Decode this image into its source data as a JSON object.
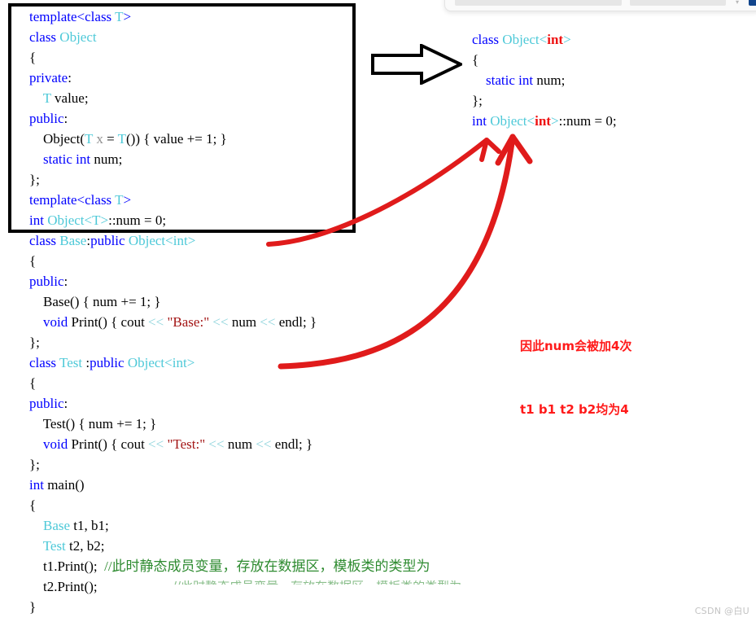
{
  "toolbar_fragment": {
    "input_primary_placeholder": "",
    "input_secondary_placeholder": "",
    "caret_glyph": "▾",
    "button_label": "",
    "accent_color": "#11458c"
  },
  "template_box": {
    "border_color": "#000000",
    "lines": [
      {
        "id": "l1",
        "indent": 0,
        "tokens": [
          {
            "t": "template",
            "c": "kw"
          },
          {
            "t": "<",
            "c": "kw"
          },
          {
            "t": "class",
            "c": "kw"
          },
          {
            "t": " ",
            "c": "plain"
          },
          {
            "t": "T",
            "c": "typ"
          },
          {
            "t": ">",
            "c": "kw"
          }
        ]
      },
      {
        "id": "l2",
        "indent": 0,
        "tokens": [
          {
            "t": "class",
            "c": "kw"
          },
          {
            "t": " ",
            "c": "plain"
          },
          {
            "t": "Object",
            "c": "typ"
          }
        ]
      },
      {
        "id": "l3",
        "indent": 0,
        "tokens": [
          {
            "t": "{",
            "c": "plain"
          }
        ]
      },
      {
        "id": "l4",
        "indent": 0,
        "tokens": [
          {
            "t": "private",
            "c": "kw"
          },
          {
            "t": ":",
            "c": "plain"
          }
        ]
      },
      {
        "id": "l5",
        "indent": 1,
        "tokens": [
          {
            "t": "T",
            "c": "typ"
          },
          {
            "t": " value;",
            "c": "plain"
          }
        ]
      },
      {
        "id": "l6",
        "indent": 0,
        "tokens": [
          {
            "t": "public",
            "c": "kw"
          },
          {
            "t": ":",
            "c": "plain"
          }
        ]
      },
      {
        "id": "l7",
        "indent": 1,
        "tokens": [
          {
            "t": "Object",
            "c": "plain"
          },
          {
            "t": "(",
            "c": "plain"
          },
          {
            "t": "T",
            "c": "typ"
          },
          {
            "t": " ",
            "c": "plain"
          },
          {
            "t": "x",
            "c": "param"
          },
          {
            "t": " = ",
            "c": "plain"
          },
          {
            "t": "T",
            "c": "typ"
          },
          {
            "t": "()) { value += 1; }",
            "c": "plain"
          }
        ]
      },
      {
        "id": "l8",
        "indent": 1,
        "tokens": [
          {
            "t": "static",
            "c": "kw"
          },
          {
            "t": " ",
            "c": "plain"
          },
          {
            "t": "int",
            "c": "kw"
          },
          {
            "t": " num;",
            "c": "plain"
          }
        ]
      },
      {
        "id": "l9",
        "indent": 0,
        "tokens": [
          {
            "t": "};",
            "c": "plain"
          }
        ]
      },
      {
        "id": "l10",
        "indent": 0,
        "tokens": [
          {
            "t": "template",
            "c": "kw"
          },
          {
            "t": "<",
            "c": "kw"
          },
          {
            "t": "class",
            "c": "kw"
          },
          {
            "t": " ",
            "c": "plain"
          },
          {
            "t": "T",
            "c": "typ"
          },
          {
            "t": ">",
            "c": "kw"
          }
        ]
      },
      {
        "id": "l11",
        "indent": 0,
        "tokens": [
          {
            "t": "int",
            "c": "kw"
          },
          {
            "t": " ",
            "c": "plain"
          },
          {
            "t": "Object",
            "c": "typ"
          },
          {
            "t": "<",
            "c": "typ"
          },
          {
            "t": "T",
            "c": "typ"
          },
          {
            "t": ">",
            "c": "typ"
          },
          {
            "t": "::num = 0;",
            "c": "plain"
          }
        ]
      }
    ]
  },
  "left_code_rest": {
    "lines": [
      {
        "id": "r1",
        "indent": 0,
        "tokens": [
          {
            "t": "class",
            "c": "kw"
          },
          {
            "t": " ",
            "c": "plain"
          },
          {
            "t": "Base",
            "c": "typ"
          },
          {
            "t": ":",
            "c": "plain"
          },
          {
            "t": "public",
            "c": "kw"
          },
          {
            "t": " ",
            "c": "plain"
          },
          {
            "t": "Object",
            "c": "typ"
          },
          {
            "t": "<",
            "c": "typ"
          },
          {
            "t": "int",
            "c": "typ"
          },
          {
            "t": ">",
            "c": "typ"
          }
        ]
      },
      {
        "id": "r2",
        "indent": 0,
        "tokens": [
          {
            "t": "{",
            "c": "plain"
          }
        ]
      },
      {
        "id": "r3",
        "indent": 0,
        "tokens": [
          {
            "t": "public",
            "c": "kw"
          },
          {
            "t": ":",
            "c": "plain"
          }
        ]
      },
      {
        "id": "r4",
        "indent": 1,
        "tokens": [
          {
            "t": "Base() { num += 1; }",
            "c": "plain"
          }
        ]
      },
      {
        "id": "r5",
        "indent": 1,
        "tokens": [
          {
            "t": "void",
            "c": "kw"
          },
          {
            "t": " Print() { cout ",
            "c": "plain"
          },
          {
            "t": "<<",
            "c": "op"
          },
          {
            "t": " ",
            "c": "plain"
          },
          {
            "t": "\"Base:\"",
            "c": "str"
          },
          {
            "t": " ",
            "c": "plain"
          },
          {
            "t": "<<",
            "c": "op"
          },
          {
            "t": " num ",
            "c": "plain"
          },
          {
            "t": "<<",
            "c": "op"
          },
          {
            "t": " endl; }",
            "c": "plain"
          }
        ]
      },
      {
        "id": "r6",
        "indent": 0,
        "tokens": [
          {
            "t": "};",
            "c": "plain"
          }
        ]
      },
      {
        "id": "r7",
        "indent": 0,
        "tokens": [
          {
            "t": "class",
            "c": "kw"
          },
          {
            "t": " ",
            "c": "plain"
          },
          {
            "t": "Test",
            "c": "typ"
          },
          {
            "t": " :",
            "c": "plain"
          },
          {
            "t": "public",
            "c": "kw"
          },
          {
            "t": " ",
            "c": "plain"
          },
          {
            "t": "Object",
            "c": "typ"
          },
          {
            "t": "<",
            "c": "typ"
          },
          {
            "t": "int",
            "c": "typ"
          },
          {
            "t": ">",
            "c": "typ"
          }
        ]
      },
      {
        "id": "r8",
        "indent": 0,
        "tokens": [
          {
            "t": "{",
            "c": "plain"
          }
        ]
      },
      {
        "id": "r9",
        "indent": 0,
        "tokens": [
          {
            "t": "public",
            "c": "kw"
          },
          {
            "t": ":",
            "c": "plain"
          }
        ]
      },
      {
        "id": "r10",
        "indent": 1,
        "tokens": [
          {
            "t": "Test() { num += 1; }",
            "c": "plain"
          }
        ]
      },
      {
        "id": "r11",
        "indent": 1,
        "tokens": [
          {
            "t": "void",
            "c": "kw"
          },
          {
            "t": " Print() { cout ",
            "c": "plain"
          },
          {
            "t": "<<",
            "c": "op"
          },
          {
            "t": " ",
            "c": "plain"
          },
          {
            "t": "\"Test:\"",
            "c": "str"
          },
          {
            "t": " ",
            "c": "plain"
          },
          {
            "t": "<<",
            "c": "op"
          },
          {
            "t": " num ",
            "c": "plain"
          },
          {
            "t": "<<",
            "c": "op"
          },
          {
            "t": " endl; }",
            "c": "plain"
          }
        ]
      },
      {
        "id": "r12",
        "indent": 0,
        "tokens": [
          {
            "t": "};",
            "c": "plain"
          }
        ]
      },
      {
        "id": "r13",
        "indent": 0,
        "tokens": [
          {
            "t": "int",
            "c": "kw"
          },
          {
            "t": " main()",
            "c": "plain"
          }
        ]
      },
      {
        "id": "r14",
        "indent": 0,
        "tokens": [
          {
            "t": "{",
            "c": "plain"
          }
        ]
      },
      {
        "id": "r15",
        "indent": 1,
        "tokens": [
          {
            "t": "Base",
            "c": "typ"
          },
          {
            "t": " t1, b1;",
            "c": "plain"
          }
        ]
      },
      {
        "id": "r16",
        "indent": 1,
        "tokens": [
          {
            "t": "Test",
            "c": "typ"
          },
          {
            "t": " t2, b2;",
            "c": "plain"
          }
        ]
      },
      {
        "id": "r17",
        "indent": 1,
        "tokens": [
          {
            "t": "t1.Print();  ",
            "c": "plain"
          },
          {
            "t": "//此时静态成员变量，存放在数据区，模板类的类型为",
            "c": "cmt"
          }
        ]
      },
      {
        "id": "r18",
        "indent": 1,
        "tokens": [
          {
            "t": "t2.Print();",
            "c": "plain"
          }
        ]
      },
      {
        "id": "r19",
        "indent": 0,
        "tokens": [
          {
            "t": "}",
            "c": "plain"
          }
        ]
      }
    ]
  },
  "right_code": {
    "lines": [
      {
        "id": "g1",
        "indent": 0,
        "tokens": [
          {
            "t": "class",
            "c": "kw"
          },
          {
            "t": " ",
            "c": "plain"
          },
          {
            "t": "Object",
            "c": "typ"
          },
          {
            "t": "<",
            "c": "typ"
          },
          {
            "t": "int",
            "c": "red-b"
          },
          {
            "t": ">",
            "c": "typ"
          }
        ]
      },
      {
        "id": "g2",
        "indent": 0,
        "tokens": [
          {
            "t": "{",
            "c": "plain"
          }
        ]
      },
      {
        "id": "g3",
        "indent": 1,
        "tokens": [
          {
            "t": "static",
            "c": "kw"
          },
          {
            "t": " ",
            "c": "plain"
          },
          {
            "t": "int",
            "c": "kw"
          },
          {
            "t": " num;",
            "c": "plain"
          }
        ]
      },
      {
        "id": "g4",
        "indent": 0,
        "tokens": [
          {
            "t": "};",
            "c": "plain"
          }
        ]
      },
      {
        "id": "g5",
        "indent": 0,
        "tokens": [
          {
            "t": "int",
            "c": "kw"
          },
          {
            "t": " ",
            "c": "plain"
          },
          {
            "t": "Object",
            "c": "typ"
          },
          {
            "t": "<",
            "c": "typ"
          },
          {
            "t": "int",
            "c": "red-b"
          },
          {
            "t": ">",
            "c": "typ"
          },
          {
            "t": "::num = 0;",
            "c": "plain"
          }
        ]
      }
    ]
  },
  "annotations": {
    "red_note_line1": "因此num会被加4次",
    "red_note_line2": "t1 b1 t2 b2均为4",
    "red_color": "#ff1a1a",
    "faded_comment": "//此时静态成员变量，存放在数据区，模板类的类型为",
    "arrow_color": "#e01b1b",
    "big_arrow_label": "instantiates-to"
  },
  "watermark": {
    "text": "CSDN @白U"
  },
  "palette": {
    "keyword": "#0000ff",
    "type": "#4ec9d8",
    "string": "#a31515",
    "comment": "#2e8b30",
    "operator": "#8fd4dc",
    "highlight": "#ee1111"
  }
}
